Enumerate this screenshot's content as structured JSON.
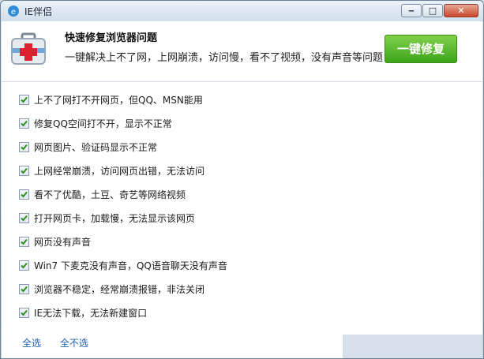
{
  "window": {
    "title": "IE伴侣",
    "buttons": [
      "minimize",
      "maximize",
      "close"
    ]
  },
  "header": {
    "title": "快速修复浏览器问题",
    "subtitle": "一键解决上不了网，上网崩溃，访问慢，看不了视频，没有声音等问题",
    "fix_button": "一键修复"
  },
  "options": [
    {
      "label": "上不了网打不开网页，但QQ、MSN能用",
      "checked": true
    },
    {
      "label": "修复QQ空间打不开，显示不正常",
      "checked": true
    },
    {
      "label": "网页图片、验证码显示不正常",
      "checked": true
    },
    {
      "label": "上网经常崩溃，访问网页出错，无法访问",
      "checked": true
    },
    {
      "label": "看不了优酷，土豆、奇艺等网络视频",
      "checked": true
    },
    {
      "label": "打开网页卡，加载慢，无法显示该网页",
      "checked": true
    },
    {
      "label": "网页没有声音",
      "checked": true
    },
    {
      "label": "Win7 下麦克没有声音，QQ语音聊天没有声音",
      "checked": true
    },
    {
      "label": "浏览器不稳定，经常崩溃报错，非法关闭",
      "checked": true
    },
    {
      "label": "IE无法下载，无法新建窗口",
      "checked": true
    }
  ],
  "links": {
    "select_all": "全选",
    "select_none": "全不选"
  },
  "colors": {
    "accent_green": "#4caf25",
    "link_blue": "#1f5fb3",
    "check_green": "#2f8f1f"
  },
  "icons": {
    "app": "ie-icon",
    "header": "first-aid-kit-icon",
    "checkbox": "check-icon"
  }
}
